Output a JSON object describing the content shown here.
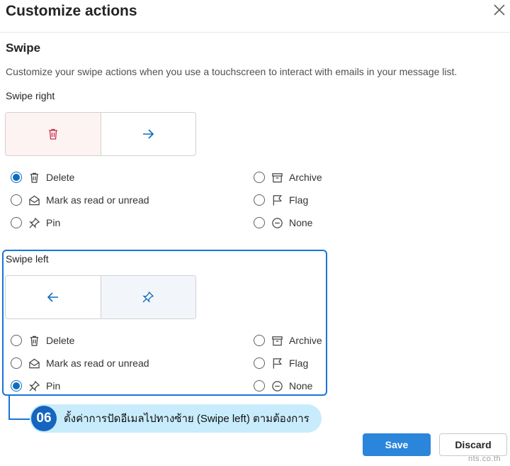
{
  "dialog": {
    "title": "Customize actions",
    "close_label": "Close"
  },
  "swipe": {
    "title": "Swipe",
    "description": "Customize your swipe actions when you use a touchscreen to interact with emails in your message list."
  },
  "swipe_right": {
    "label": "Swipe right",
    "selected": "Delete",
    "options": {
      "delete": "Delete",
      "read": "Mark as read or unread",
      "pin": "Pin",
      "archive": "Archive",
      "flag": "Flag",
      "none": "None"
    }
  },
  "swipe_left": {
    "label": "Swipe left",
    "selected": "Pin",
    "options": {
      "delete": "Delete",
      "read": "Mark as read or unread",
      "pin": "Pin",
      "archive": "Archive",
      "flag": "Flag",
      "none": "None"
    }
  },
  "annotation": {
    "step": "06",
    "text": "ตั้งค่าการปัดอีเมลไปทางซ้าย (Swipe left) ตามต้องการ"
  },
  "footer": {
    "save_label": "Save",
    "discard_label": "Discard"
  },
  "watermark": "nts.co.th",
  "colors": {
    "accent": "#0f6cbd",
    "delete": "#c4314b",
    "highlight": "#1a73d9",
    "callout_bg": "#c8ecfb"
  }
}
